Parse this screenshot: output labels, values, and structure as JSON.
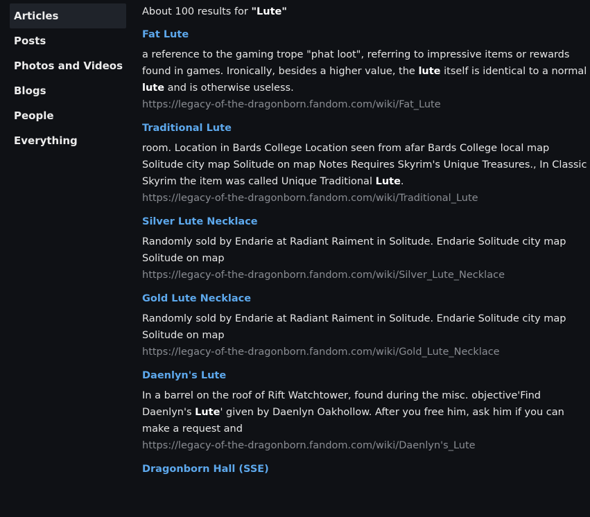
{
  "sidebar": {
    "items": [
      {
        "label": "Articles",
        "active": true
      },
      {
        "label": "Posts",
        "active": false
      },
      {
        "label": "Photos and Videos",
        "active": false
      },
      {
        "label": "Blogs",
        "active": false
      },
      {
        "label": "People",
        "active": false
      },
      {
        "label": "Everything",
        "active": false
      }
    ]
  },
  "summary": {
    "prefix": "About 100 results for ",
    "query": "\"Lute\""
  },
  "results": [
    {
      "title": "Fat Lute",
      "snippet": [
        {
          "text": "a reference to the gaming trope \"phat loot\", referring to impressive items or rewards found in games. Ironically, besides a higher value, the ",
          "bold": false
        },
        {
          "text": "lute",
          "bold": true
        },
        {
          "text": " itself is identical to a normal ",
          "bold": false
        },
        {
          "text": "lute",
          "bold": true
        },
        {
          "text": " and is otherwise useless.",
          "bold": false
        }
      ],
      "url": "https://legacy-of-the-dragonborn.fandom.com/wiki/Fat_Lute"
    },
    {
      "title": "Traditional Lute",
      "snippet": [
        {
          "text": "room. Location in Bards College Location seen from afar Bards College local map Solitude city map Solitude on map Notes Requires Skyrim's Unique Treasures., In Classic Skyrim the item was called Unique Traditional ",
          "bold": false
        },
        {
          "text": "Lute",
          "bold": true
        },
        {
          "text": ".",
          "bold": false
        }
      ],
      "url": "https://legacy-of-the-dragonborn.fandom.com/wiki/Traditional_Lute"
    },
    {
      "title": "Silver Lute Necklace",
      "snippet": [
        {
          "text": "Randomly sold by Endarie at Radiant Raiment in Solitude. Endarie Solitude city map Solitude on map",
          "bold": false
        }
      ],
      "url": "https://legacy-of-the-dragonborn.fandom.com/wiki/Silver_Lute_Necklace"
    },
    {
      "title": "Gold Lute Necklace",
      "snippet": [
        {
          "text": "Randomly sold by Endarie at Radiant Raiment in Solitude. Endarie Solitude city map Solitude on map",
          "bold": false
        }
      ],
      "url": "https://legacy-of-the-dragonborn.fandom.com/wiki/Gold_Lute_Necklace"
    },
    {
      "title": "Daenlyn's Lute",
      "snippet": [
        {
          "text": "In a barrel on the roof of Rift Watchtower, found during the misc. objective'Find Daenlyn's ",
          "bold": false
        },
        {
          "text": "Lute",
          "bold": true
        },
        {
          "text": "' given by Daenlyn Oakhollow. After you free him, ask him if you can make a request and",
          "bold": false
        }
      ],
      "url": "https://legacy-of-the-dragonborn.fandom.com/wiki/Daenlyn's_Lute"
    },
    {
      "title": "Dragonborn Hall (SSE)",
      "snippet": [],
      "url": ""
    }
  ]
}
